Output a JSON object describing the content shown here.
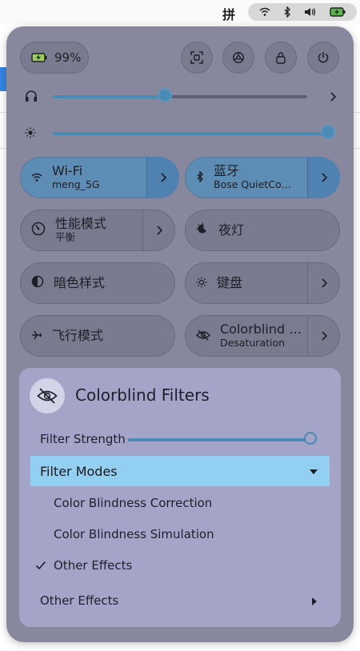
{
  "topbar": {
    "ime_label": "拼",
    "tray_icons": [
      "wifi-icon",
      "bluetooth-icon",
      "volume-icon",
      "battery-charging-icon"
    ]
  },
  "panel": {
    "battery": {
      "label": "99%",
      "icon": "battery-charging-icon"
    },
    "actions": [
      "screenshot-icon",
      "settings-icon",
      "lock-icon",
      "power-icon"
    ],
    "volume": {
      "icon": "headphones-icon",
      "level": 0.44
    },
    "brightness": {
      "icon": "brightness-icon",
      "level": 1.0
    },
    "tiles": {
      "wifi": {
        "label": "Wi-Fi",
        "sub": "meng_5G",
        "active": true
      },
      "bluetooth": {
        "label": "蓝牙",
        "sub": "Bose QuietCo…",
        "active": true
      },
      "power_mode": {
        "label": "性能模式",
        "sub": "平衡"
      },
      "night_light": {
        "label": "夜灯"
      },
      "dark_style": {
        "label": "暗色样式"
      },
      "keyboard": {
        "label": "键盘"
      },
      "airplane": {
        "label": "飞行模式"
      },
      "colorblind": {
        "label": "Colorblind …",
        "sub": "Desaturation"
      }
    }
  },
  "submenu": {
    "title": "Colorblind Filters",
    "filter_strength_label": "Filter Strength",
    "filter_strength_level": 1.0,
    "modes_header": "Filter Modes",
    "modes": [
      {
        "label": "Color Blindness Correction",
        "checked": false
      },
      {
        "label": "Color Blindness Simulation",
        "checked": false
      },
      {
        "label": "Other Effects",
        "checked": true
      }
    ],
    "other_effects_label": "Other Effects"
  },
  "colors": {
    "panel_bg": "#87889d",
    "active_tile": "#5d8db5",
    "submenu_bg": "#a3a4c8",
    "highlight": "#93cff0",
    "accent": "#4a8bb5"
  }
}
